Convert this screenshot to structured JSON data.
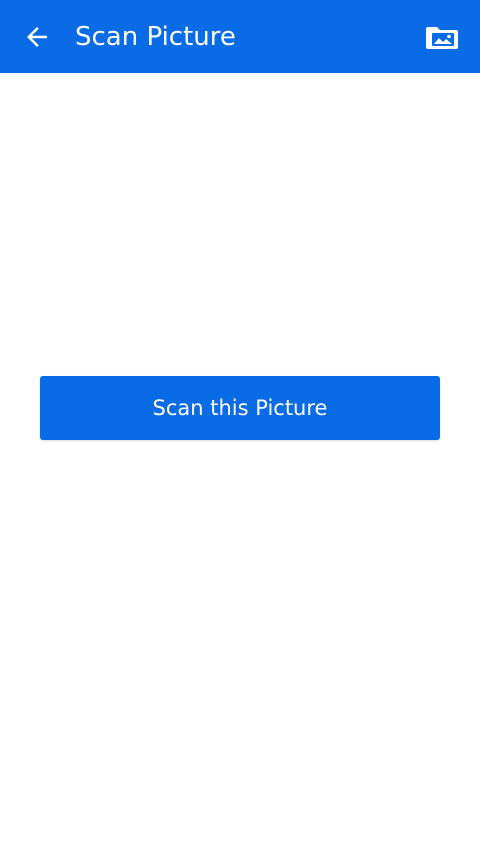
{
  "app_bar": {
    "title": "Scan Picture",
    "back_icon": "arrow-left-icon",
    "gallery_icon": "image-folder-icon",
    "background_color": "#0a6be6",
    "foreground_color": "#ffffff"
  },
  "main": {
    "scan_button_label": "Scan this Picture",
    "scan_button_color": "#0a6be6"
  }
}
